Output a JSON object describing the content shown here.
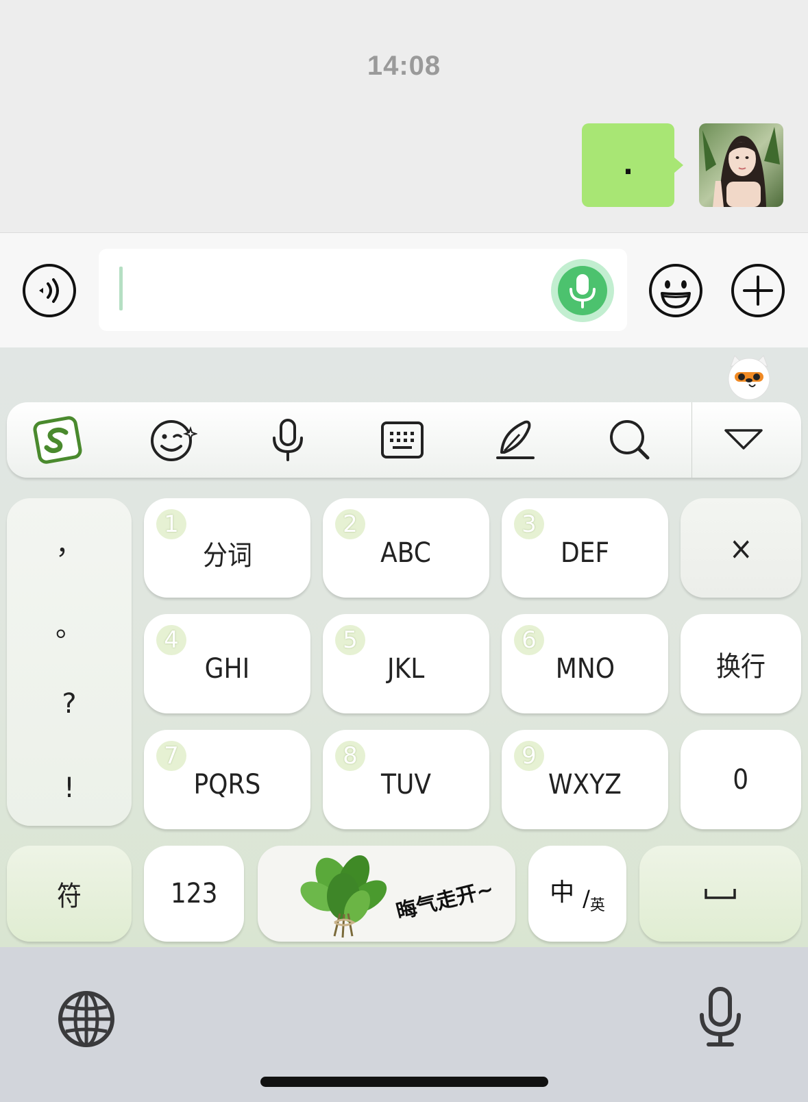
{
  "chat": {
    "time": "14:08",
    "message_text": "."
  },
  "input_bar": {
    "voice_icon": "voice-wave-icon",
    "text_value": "",
    "mic_icon": "microphone-icon",
    "emoji_icon": "smiley-icon",
    "plus_icon": "plus-circle-icon"
  },
  "keyboard": {
    "toolbar": [
      "sogou-logo-icon",
      "emoji-wink-icon",
      "microphone-icon",
      "keyboard-icon",
      "handwriting-pen-icon",
      "search-icon",
      "collapse-triangle-icon"
    ],
    "punctuation": [
      "，",
      "。",
      "?",
      "!"
    ],
    "keys": [
      {
        "num": "1",
        "label": "分词"
      },
      {
        "num": "2",
        "label": "ABC"
      },
      {
        "num": "3",
        "label": "DEF"
      },
      {
        "num": "4",
        "label": "GHI"
      },
      {
        "num": "5",
        "label": "JKL"
      },
      {
        "num": "6",
        "label": "MNO"
      },
      {
        "num": "7",
        "label": "PQRS"
      },
      {
        "num": "8",
        "label": "TUV"
      },
      {
        "num": "9",
        "label": "WXYZ"
      }
    ],
    "delete_label": "×",
    "newline_label": "换行",
    "zero_label": "0",
    "symbols_label": "符",
    "numbers_label": "123",
    "sticker_text": "晦气走开~",
    "lang_switch": {
      "main": "中",
      "sep": "/",
      "sub": "英"
    },
    "space_icon": "space-bar-icon"
  },
  "system": {
    "globe_icon": "globe-icon",
    "dictation_icon": "microphone-icon"
  },
  "colors": {
    "bubble": "#a8e674",
    "accent_green": "#4cc26e",
    "chat_bg": "#ededed"
  }
}
